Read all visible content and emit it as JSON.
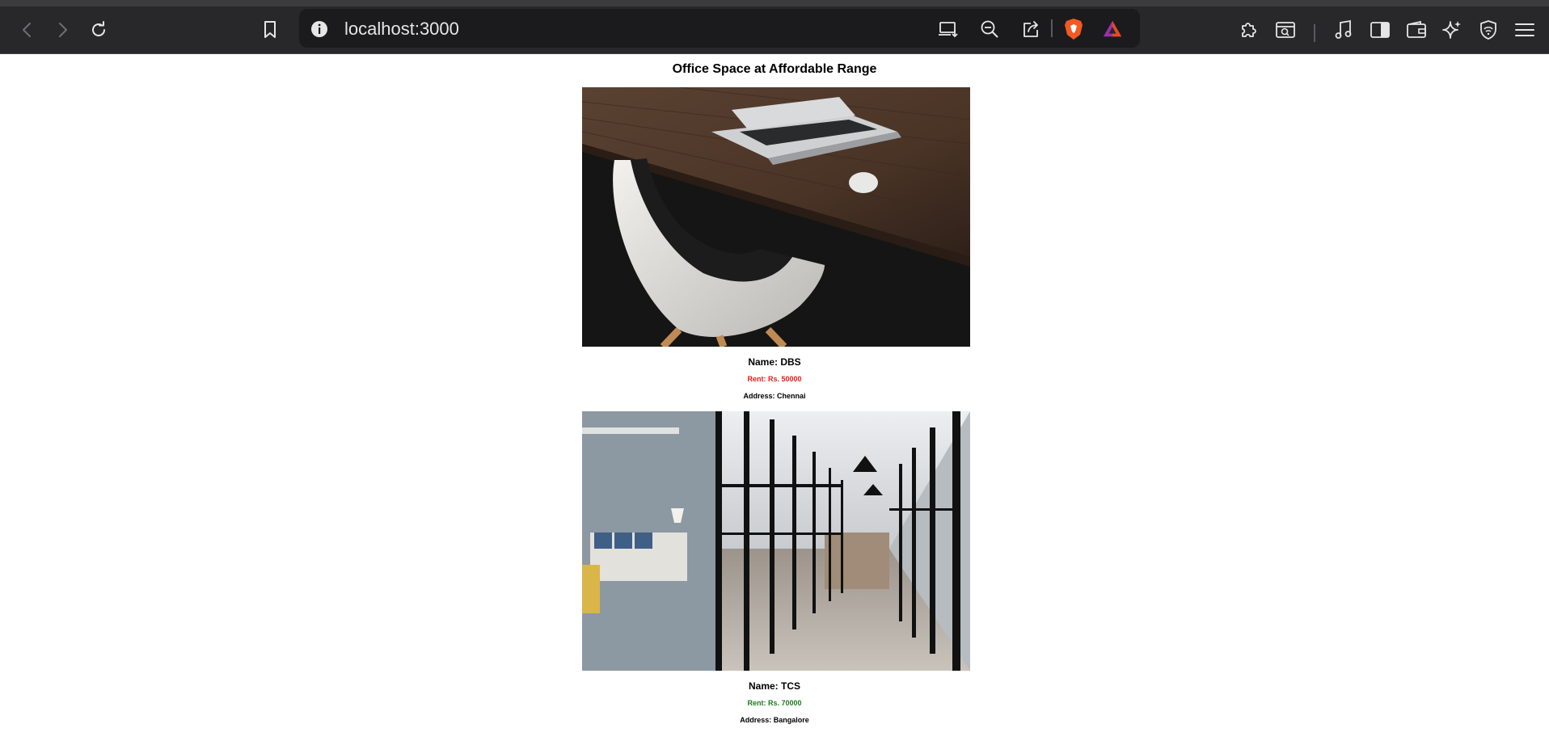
{
  "browser": {
    "url": "localhost:3000",
    "icons": [
      "back-icon",
      "forward-icon",
      "reload-icon",
      "bookmark-icon",
      "site-info-icon",
      "install-icon",
      "zoom-out-icon",
      "share-icon",
      "brave-shields-icon",
      "brave-rewards-icon",
      "extensions-icon",
      "page-search-icon",
      "media-icon",
      "sidebar-icon",
      "wallet-icon",
      "leo-ai-icon",
      "vpn-icon",
      "menu-icon"
    ]
  },
  "page": {
    "heading": "Office Space at Affordable Range",
    "offices": [
      {
        "image": "laptop-desk-chair-photo",
        "name": "Name: DBS",
        "rent": "Rent: Rs. 50000",
        "rent_color": "#e31b1b",
        "address": "Address: Chennai"
      },
      {
        "image": "glass-office-corridor-photo",
        "name": "Name: TCS",
        "rent": "Rent: Rs. 70000",
        "rent_color": "#1e7a1e",
        "address": "Address: Bangalore"
      }
    ]
  }
}
